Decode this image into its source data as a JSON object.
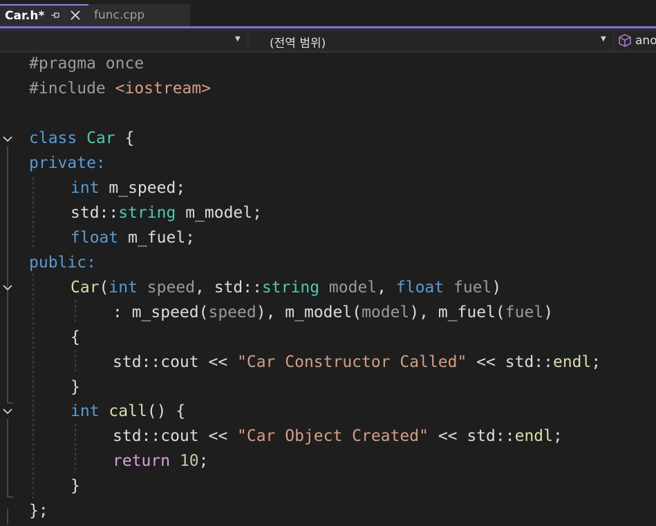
{
  "tabs": [
    {
      "label": "Car.h*",
      "active": true,
      "pin_icon": "pin-icon",
      "close_icon": "close-icon"
    },
    {
      "label": "func.cpp",
      "active": false
    }
  ],
  "navbar": {
    "scope": "(전역 범위)",
    "member": "ano"
  },
  "colors": {
    "accent": "#8c6ddb",
    "keyword": "#569cd6",
    "type": "#4ec9b0",
    "function": "#dcdcaa",
    "string": "#d69d85",
    "number": "#b5cea8",
    "control": "#d8a0df"
  },
  "code": {
    "l1a": "#pragma",
    "l1b": " once",
    "l2a": "#include",
    "l2b": " <iostream>",
    "l4a": "class",
    "l4b": "Car",
    "l4c": " {",
    "l5": "private:",
    "l6a": "int",
    "l6b": " m_speed;",
    "l7a": "std::",
    "l7b": "string",
    "l7c": " m_model;",
    "l8a": "float",
    "l8b": " m_fuel;",
    "l9": "public:",
    "l10a": "Car",
    "l10b": "(",
    "l10c": "int",
    "l10d": " speed",
    "l10e": ", std::",
    "l10f": "string",
    "l10g": " model",
    "l10h": ", ",
    "l10i": "float",
    "l10j": " fuel",
    "l10k": ")",
    "l11a": ": m_speed(",
    "l11b": "speed",
    "l11c": "), m_model(",
    "l11d": "model",
    "l11e": "), m_fuel(",
    "l11f": "fuel",
    "l11g": ")",
    "l12": "{",
    "l13a": "std::cout << ",
    "l13b": "\"Car Constructor Called\"",
    "l13c": " << std::",
    "l13d": "endl",
    "l13e": ";",
    "l14": "}",
    "l15a": "int",
    "l15b": "call",
    "l15c": "() {",
    "l16a": "std::cout << ",
    "l16b": "\"Car Object Created\"",
    "l16c": " << std::",
    "l16d": "endl",
    "l16e": ";",
    "l17a": "return",
    "l17b": "10",
    "l17c": ";",
    "l18": "}",
    "l19": "};"
  }
}
